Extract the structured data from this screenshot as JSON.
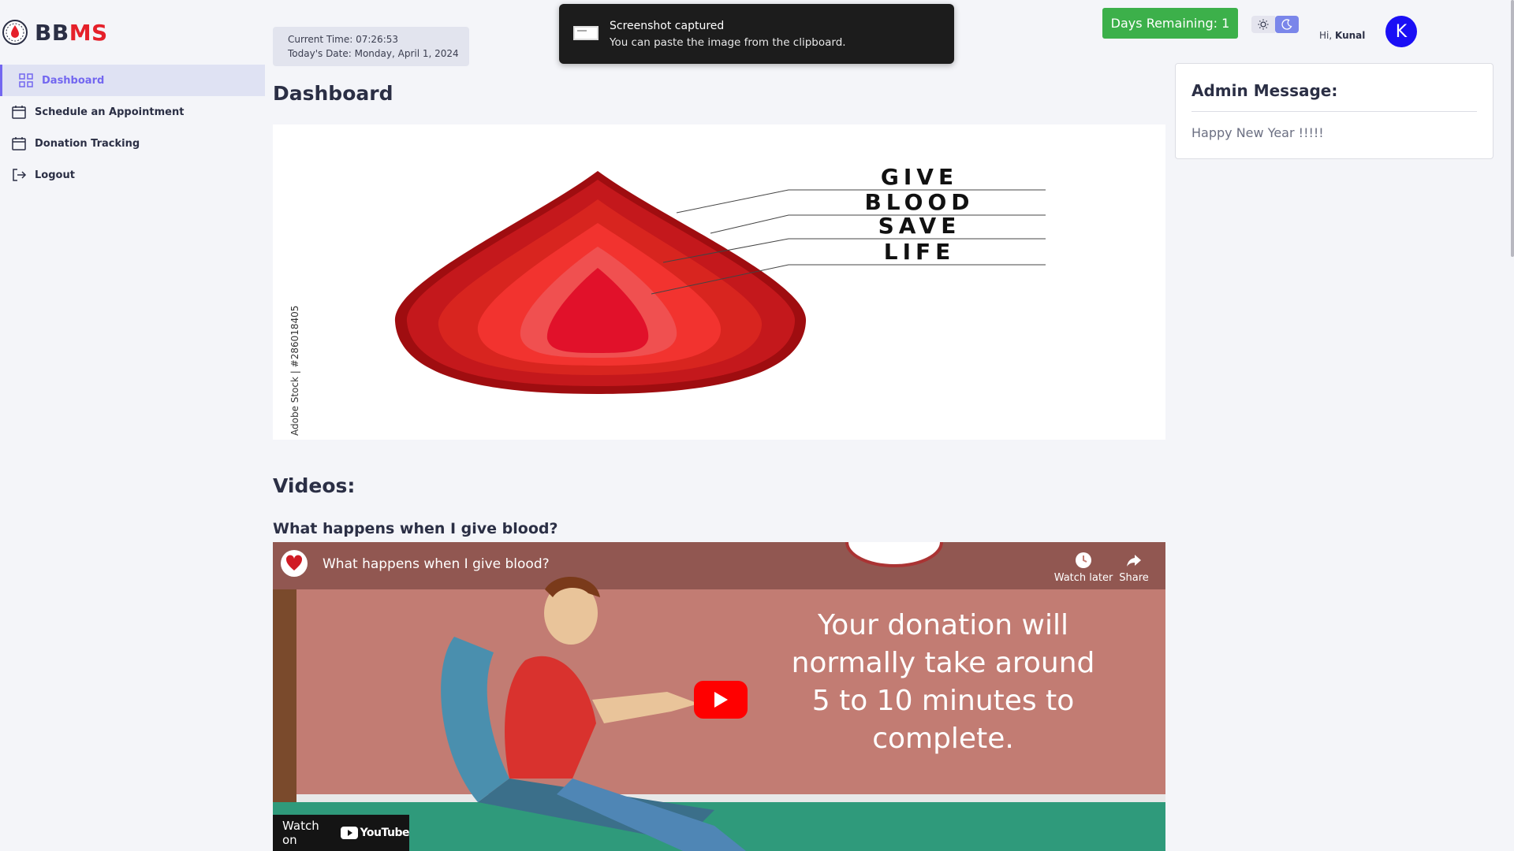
{
  "brand": {
    "prefix": "BB",
    "suffix": "MS"
  },
  "sidebar": {
    "items": [
      {
        "label": "Dashboard",
        "icon": "grid-icon",
        "active": true
      },
      {
        "label": "Schedule an Appointment",
        "icon": "calendar-icon",
        "active": false
      },
      {
        "label": "Donation Tracking",
        "icon": "calendar-icon",
        "active": false
      },
      {
        "label": "Logout",
        "icon": "logout-icon",
        "active": false
      }
    ]
  },
  "timebox": {
    "current_time": "Current Time: 07:26:53",
    "date": "Today's Date: Monday, April 1, 2024"
  },
  "toast": {
    "title": "Screenshot captured",
    "body": "You can paste the image from the clipboard."
  },
  "header": {
    "days_remaining": "Days Remaining: 1",
    "greeting_prefix": "Hi,",
    "username": "Kunal",
    "avatar_letter": "K"
  },
  "main": {
    "title": "Dashboard",
    "banner": {
      "words": [
        "GIVE",
        "BLOOD",
        "SAVE",
        "LIFE"
      ],
      "watermark": "Adobe Stock | #286018405"
    },
    "videos_title": "Videos:",
    "video": {
      "heading": "What happens when I give blood?",
      "player_title": "What happens when I give blood?",
      "watch_later": "Watch later",
      "share": "Share",
      "caption": [
        "Your donation will",
        "normally take around",
        "5 to 10 minutes to",
        "complete."
      ],
      "watch_on": "Watch on",
      "youtube": "YouTube"
    }
  },
  "admin": {
    "title": "Admin Message:",
    "message": "Happy New Year !!!!!"
  },
  "colors": {
    "accent": "#7367f0",
    "brand_red": "#e5202a",
    "success": "#3cb04a",
    "avatar": "#1a0ff5"
  }
}
